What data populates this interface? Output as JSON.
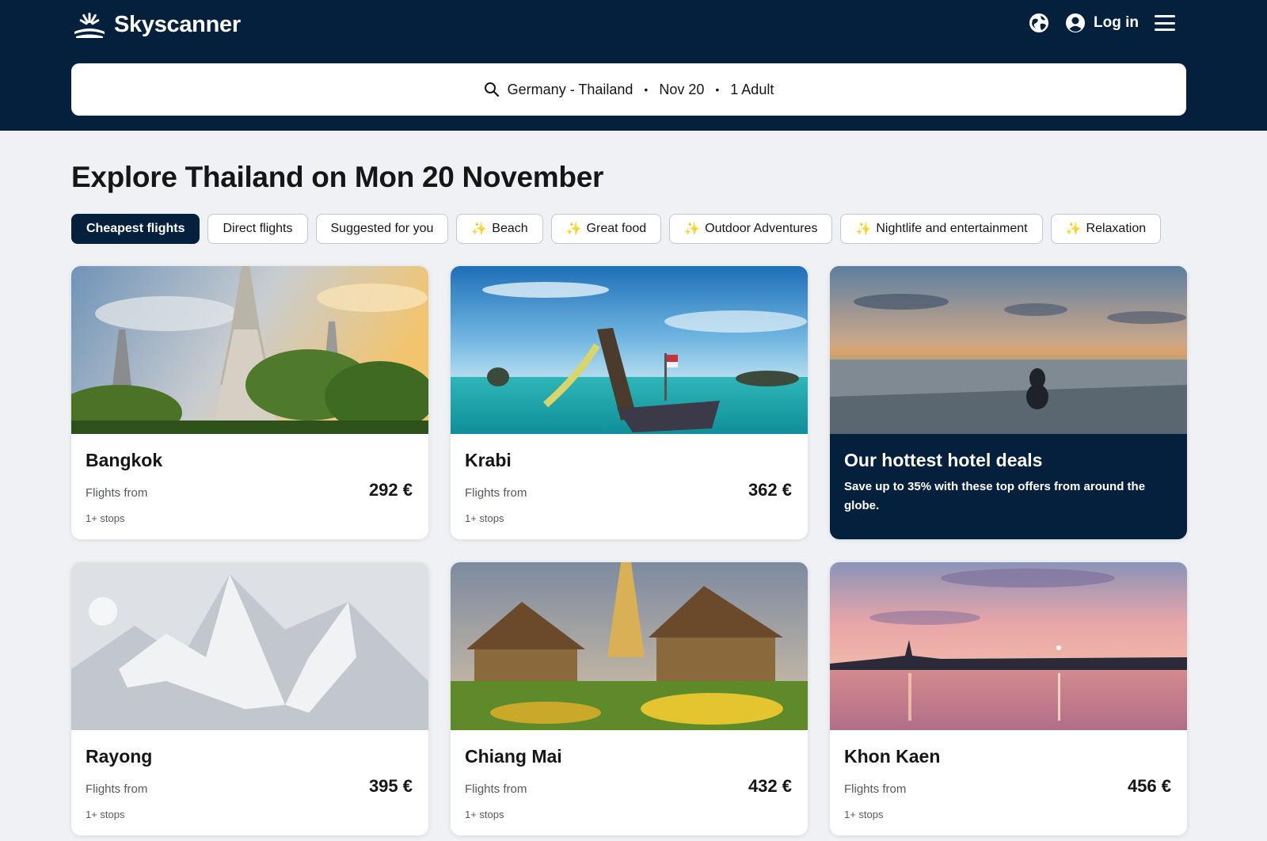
{
  "header": {
    "logo_text": "Skyscanner",
    "login_label": "Log in",
    "icons": [
      "globe-icon",
      "account-icon",
      "menu-icon"
    ]
  },
  "search": {
    "route": "Germany - Thailand",
    "date": "Nov 20",
    "travellers": "1 Adult",
    "separator": "•"
  },
  "page_title": "Explore Thailand on Mon 20 November",
  "filters": [
    {
      "label": "Cheapest flights",
      "active": true,
      "sparkle": false
    },
    {
      "label": "Direct flights",
      "active": false,
      "sparkle": false
    },
    {
      "label": "Suggested for you",
      "active": false,
      "sparkle": false
    },
    {
      "label": "Beach",
      "active": false,
      "sparkle": true
    },
    {
      "label": "Great food",
      "active": false,
      "sparkle": true
    },
    {
      "label": "Outdoor Adventures",
      "active": false,
      "sparkle": true
    },
    {
      "label": "Nightlife and entertainment",
      "active": false,
      "sparkle": true
    },
    {
      "label": "Relaxation",
      "active": false,
      "sparkle": true
    }
  ],
  "sparkle_glyph": "✨",
  "destinations": [
    {
      "name": "Bangkok",
      "from_label": "Flights from",
      "price": "292 €",
      "stops": "1+ stops",
      "image": "temple-photo"
    },
    {
      "name": "Krabi",
      "from_label": "Flights from",
      "price": "362 €",
      "stops": "1+ stops",
      "image": "longtail-boat-beach-photo"
    },
    {
      "name": "Rayong",
      "from_label": "Flights from",
      "price": "395 €",
      "stops": "1+ stops",
      "image": "placeholder-mountains"
    },
    {
      "name": "Chiang Mai",
      "from_label": "Flights from",
      "price": "432 €",
      "stops": "1+ stops",
      "image": "temple-garden-photo"
    },
    {
      "name": "Khon Kaen",
      "from_label": "Flights from",
      "price": "456 €",
      "stops": "1+ stops",
      "image": "lake-sunset-photo"
    }
  ],
  "hotel_deal": {
    "title": "Our hottest hotel deals",
    "text": "Save up to 35% with these top offers from around the globe.",
    "image": "infinity-pool-sunset-photo"
  },
  "colors": {
    "brand_navy": "#05203c",
    "page_bg": "#eff1f4",
    "sparkle": "#f5c518"
  }
}
